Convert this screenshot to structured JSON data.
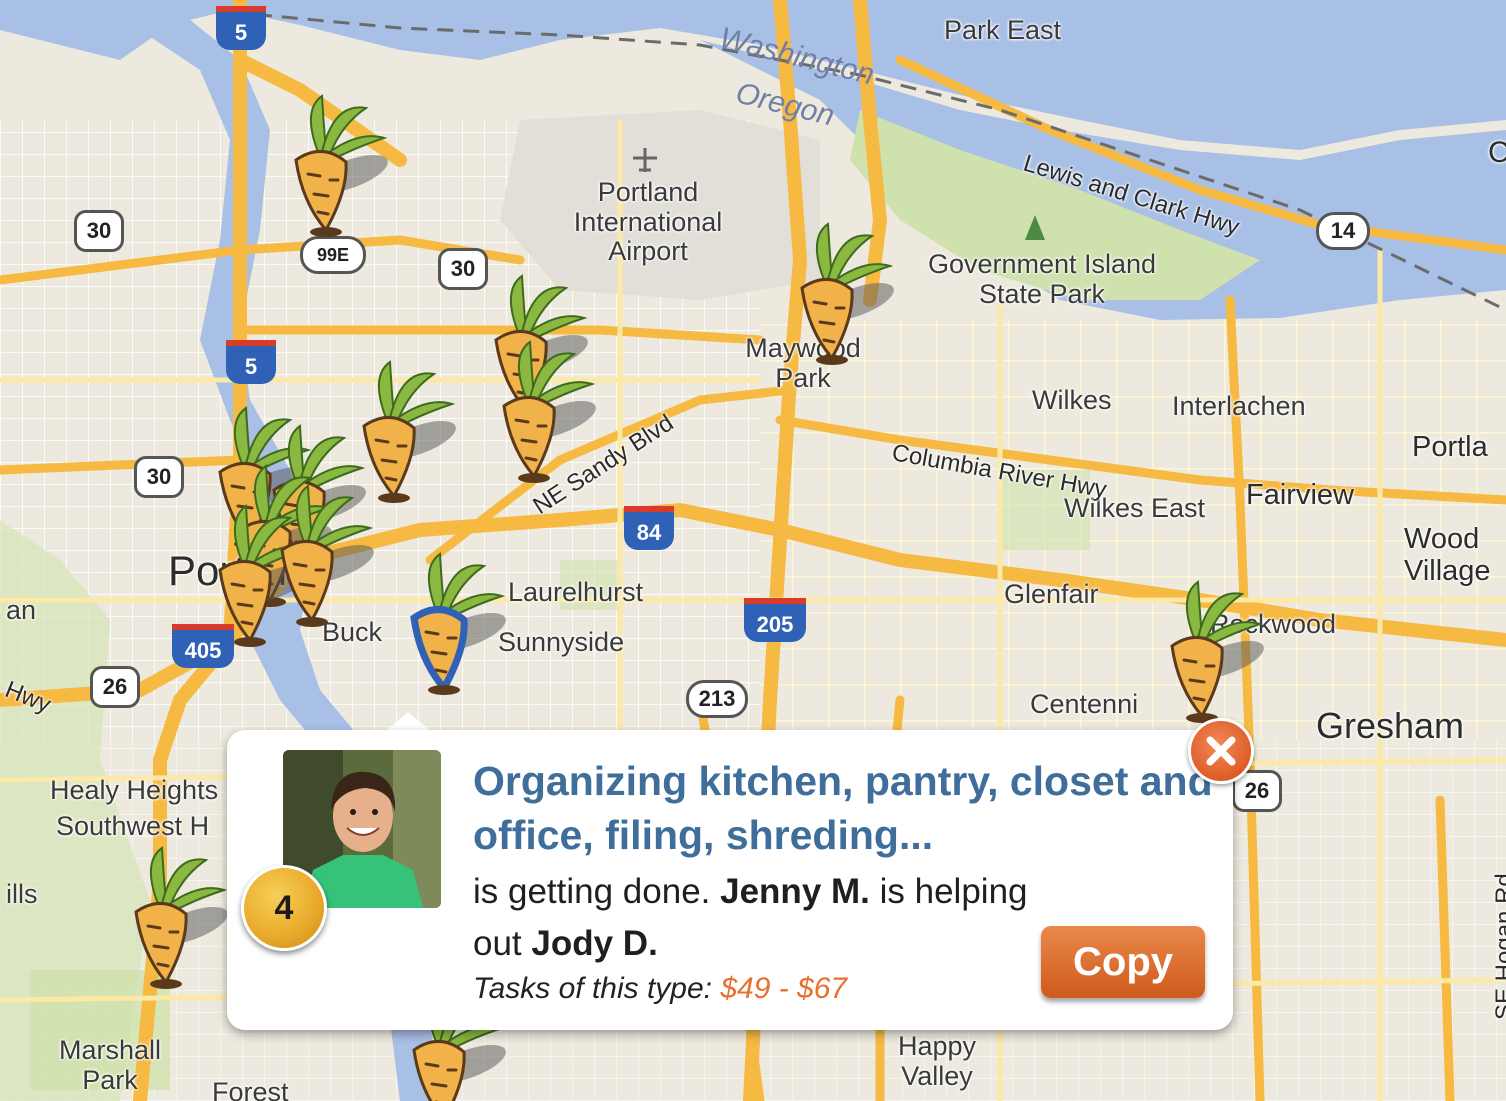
{
  "map": {
    "water_labels": [
      "Washington",
      "Oregon"
    ],
    "place_labels": [
      "Park East",
      "Portland International Airport",
      "Government Island State Park",
      "Maywood Park",
      "Wilkes",
      "Interlachen",
      "Wilkes East",
      "Fairview",
      "Portla",
      "Wood Village",
      "Laurelhurst",
      "Sunnyside",
      "Glenfair",
      "Rockwood",
      "Centenni",
      "Gresham",
      "Portland",
      "Buck",
      "an",
      "Healy Heights",
      "Southwest H",
      "ills",
      "Marshall Park",
      "Forest",
      "Happy Valley",
      "C"
    ],
    "road_labels": [
      "Lewis and Clark Hwy",
      "Columbia River Hwy",
      "NE Sandy Blvd",
      "SE Hogan Rd",
      "Hwy"
    ],
    "shields": {
      "interstate": [
        "5",
        "5",
        "84",
        "205",
        "405"
      ],
      "us_route": [
        "30",
        "30",
        "30",
        "26",
        "26"
      ],
      "state_route": [
        "99E",
        "14",
        "213"
      ]
    }
  },
  "popup": {
    "task_title": "Organizing kitchen, pantry, closet and office, filing, shreding...",
    "desc_part1": "is getting done. ",
    "tasker_name": "Jenny M.",
    "desc_part2": " is helping out ",
    "client_name": "Jody D.",
    "price_label": "Tasks of this type: ",
    "price_range": "$49 - $67",
    "badge_number": "4",
    "copy_label": "Copy",
    "close_icon": "close-x-icon"
  },
  "colors": {
    "water": "#a8bfe6",
    "highway": "#f6b942",
    "park": "#cfe2ad",
    "title_blue": "#3f6e9a",
    "price_orange": "#e8702e",
    "copy_button": "#d9642a",
    "close_button": "#e0602b",
    "badge_gold": "#e8a92a"
  },
  "markers": {
    "icon": "carrot-marker-icon",
    "selected_icon": "carrot-marker-selected-icon"
  }
}
